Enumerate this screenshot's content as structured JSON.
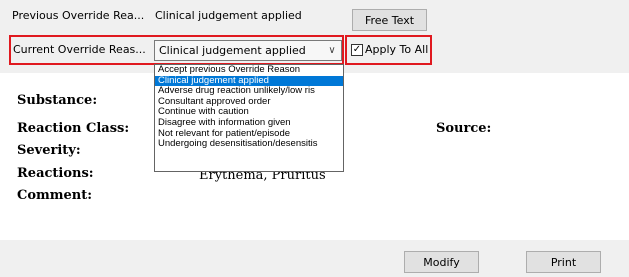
{
  "override": {
    "previous_label": "Previous Override Rea...",
    "previous_value": "Clinical judgement applied",
    "free_text_button": "Free Text",
    "current_label": "Current Override Reas...",
    "current_value": "Clinical judgement applied",
    "apply_to_all_label": "Apply To All",
    "apply_to_all_checked": true,
    "options": [
      {
        "label": "Accept previous Override Reason",
        "selected": false
      },
      {
        "label": "Clinical judgement applied",
        "selected": true
      },
      {
        "label": "Adverse drug reaction unlikely/low ris",
        "selected": false
      },
      {
        "label": "Consultant approved order",
        "selected": false
      },
      {
        "label": "Continue with caution",
        "selected": false
      },
      {
        "label": "Disagree with information given",
        "selected": false
      },
      {
        "label": "Not relevant for patient/episode",
        "selected": false
      },
      {
        "label": "Undergoing desensitisation/desensitis",
        "selected": false
      }
    ]
  },
  "details": {
    "substance_label": "Substance:",
    "reaction_class_label": "Reaction Class:",
    "source_label": "Source:",
    "severity_label": "Severity:",
    "reactions_label": "Reactions:",
    "reactions_value": "Erythema, Pruritus",
    "comment_label": "Comment:"
  },
  "footer": {
    "modify_button": "Modify",
    "print_button": "Print"
  },
  "colors": {
    "highlight_border": "#e0191f",
    "selection": "#0078d7",
    "panel_bg": "#f0f0f0"
  }
}
